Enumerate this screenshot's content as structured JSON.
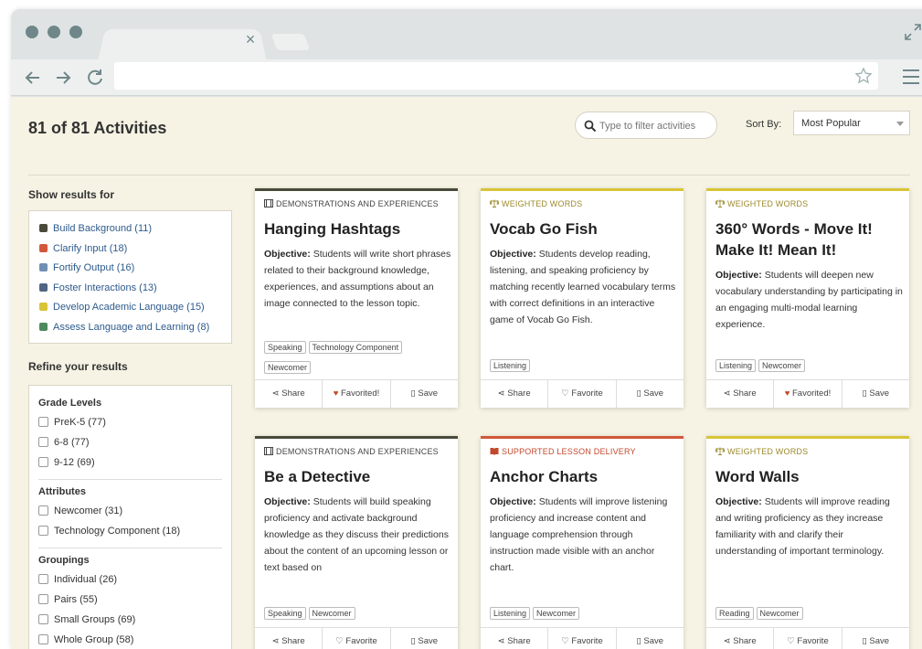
{
  "browser": {
    "tab_close": "×"
  },
  "page": {
    "title": "81 of 81 Activities",
    "filter_placeholder": "Type to filter activities",
    "sort_label": "Sort By:",
    "sort_value": "Most Popular"
  },
  "sidebar": {
    "show_results_heading": "Show results for",
    "legend": [
      {
        "label": "Build Background (11)",
        "color": "#4a4a3a"
      },
      {
        "label": "Clarify Input (18)",
        "color": "#d2583a"
      },
      {
        "label": "Fortify Output (16)",
        "color": "#6f8fb3"
      },
      {
        "label": "Foster Interactions (13)",
        "color": "#4f6581"
      },
      {
        "label": "Develop Academic Language (15)",
        "color": "#d8c436"
      },
      {
        "label": "Assess Language and Learning (8)",
        "color": "#4c8a5e"
      }
    ],
    "refine_heading": "Refine your results",
    "groups": [
      {
        "heading": "Grade Levels",
        "options": [
          "PreK-5 (77)",
          "6-8 (77)",
          "9-12 (69)"
        ]
      },
      {
        "heading": "Attributes",
        "options": [
          "Newcomer (31)",
          "Technology Component (18)"
        ]
      },
      {
        "heading": "Groupings",
        "options": [
          "Individual (26)",
          "Pairs (55)",
          "Small Groups (69)",
          "Whole Group (58)"
        ]
      }
    ]
  },
  "colors": {
    "demonstrations": "#4a4a3a",
    "weighted_words": "#d8c436",
    "supported_lesson": "#d2583a",
    "category_text_dark": "#444444",
    "category_text_gold": "#9c8a2c",
    "category_text_red": "#c2492d"
  },
  "cards": [
    {
      "category": "DEMONSTRATIONS AND EXPERIENCES",
      "title": "Hanging Hashtags",
      "objective_label": "Objective:",
      "objective": "Students will write short phrases related to their background knowledge, experiences, and assumptions about an image connected to the lesson topic.",
      "tags": [
        "Speaking",
        "Technology Component",
        "Newcomer"
      ],
      "actions": [
        "Share",
        "Favorited!",
        "Save"
      ]
    },
    {
      "category": "WEIGHTED WORDS",
      "title": "Vocab Go Fish",
      "objective_label": "Objective:",
      "objective": "Students develop reading, listening, and speaking proficiency by matching recently learned vocabulary terms with correct definitions in an interactive game of Vocab Go Fish.",
      "tags": [
        "Listening"
      ],
      "actions": [
        "Share",
        "Favorite",
        "Save"
      ]
    },
    {
      "category": "WEIGHTED WORDS",
      "title": "360° Words - Move It! Make It! Mean It!",
      "objective_label": "Objective:",
      "objective": "Students will deepen new vocabulary understanding by participating in an engaging multi-modal learning experience.",
      "tags": [
        "Listening",
        "Newcomer"
      ],
      "actions": [
        "Share",
        "Favorited!",
        "Save"
      ]
    },
    {
      "category": "DEMONSTRATIONS AND EXPERIENCES",
      "title": "Be a Detective",
      "objective_label": "Objective:",
      "objective": "Students will build speaking proficiency and activate background knowledge as they discuss their predictions about the content of an upcoming lesson or text based on",
      "tags": [
        "Speaking",
        "Newcomer"
      ],
      "actions": [
        "Share",
        "Favorite",
        "Save"
      ]
    },
    {
      "category": "SUPPORTED LESSON DELIVERY",
      "title": "Anchor Charts",
      "objective_label": "Objective:",
      "objective": "Students will improve listening proficiency and increase content and language comprehension through instruction made visible with an anchor chart.",
      "tags": [
        "Listening",
        "Newcomer"
      ],
      "actions": [
        "Share",
        "Favorite",
        "Save"
      ]
    },
    {
      "category": "WEIGHTED WORDS",
      "title": "Word Walls",
      "objective_label": "Objective:",
      "objective": "Students will improve reading and writing proficiency as they increase familiarity with and clarify their understanding of important terminology.",
      "tags": [
        "Reading",
        "Newcomer"
      ],
      "actions": [
        "Share",
        "Favorite",
        "Save"
      ]
    }
  ]
}
